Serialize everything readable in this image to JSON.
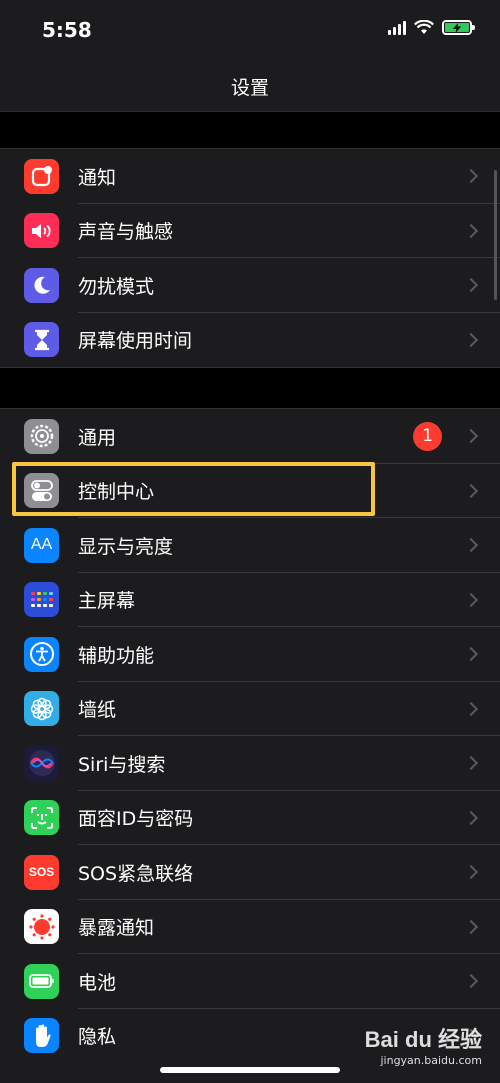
{
  "status_bar": {
    "time": "5:58"
  },
  "nav": {
    "title": "设置"
  },
  "groups": [
    {
      "items": [
        {
          "label": "通知",
          "icon": "notification-icon",
          "color": "#ff3b30"
        },
        {
          "label": "声音与触感",
          "icon": "speaker-icon",
          "color": "#ff2d55"
        },
        {
          "label": "勿扰模式",
          "icon": "moon-icon",
          "color": "#5e5ce6"
        },
        {
          "label": "屏幕使用时间",
          "icon": "hourglass-icon",
          "color": "#5e5ce6"
        }
      ]
    },
    {
      "items": [
        {
          "label": "通用",
          "icon": "gear-icon",
          "color": "#8e8e93",
          "badge": "1"
        },
        {
          "label": "控制中心",
          "icon": "toggles-icon",
          "color": "#8e8e93"
        },
        {
          "label": "显示与亮度",
          "icon": "text-size-icon",
          "color": "#0a84ff",
          "icon_text": "AA"
        },
        {
          "label": "主屏幕",
          "icon": "home-grid-icon",
          "color": "#2c4dd8"
        },
        {
          "label": "辅助功能",
          "icon": "accessibility-icon",
          "color": "#0a84ff"
        },
        {
          "label": "墙纸",
          "icon": "flower-icon",
          "color": "#32ade6"
        },
        {
          "label": "Siri与搜索",
          "icon": "siri-icon",
          "color": "#1c1c3a"
        },
        {
          "label": "面容ID与密码",
          "icon": "face-id-icon",
          "color": "#30d158"
        },
        {
          "label": "SOS紧急联络",
          "icon": "sos-icon",
          "color": "#ff3b30",
          "icon_text": "SOS"
        },
        {
          "label": "暴露通知",
          "icon": "exposure-icon",
          "color": "#ffffff"
        },
        {
          "label": "电池",
          "icon": "battery-icon",
          "color": "#30d158"
        },
        {
          "label": "隐私",
          "icon": "hand-icon",
          "color": "#0a84ff"
        }
      ]
    }
  ],
  "watermark": {
    "logo": "Bai du 经验",
    "url": "jingyan.baidu.com"
  },
  "colors": {
    "highlight": "#f5c543",
    "background": "#1c1c1e"
  }
}
